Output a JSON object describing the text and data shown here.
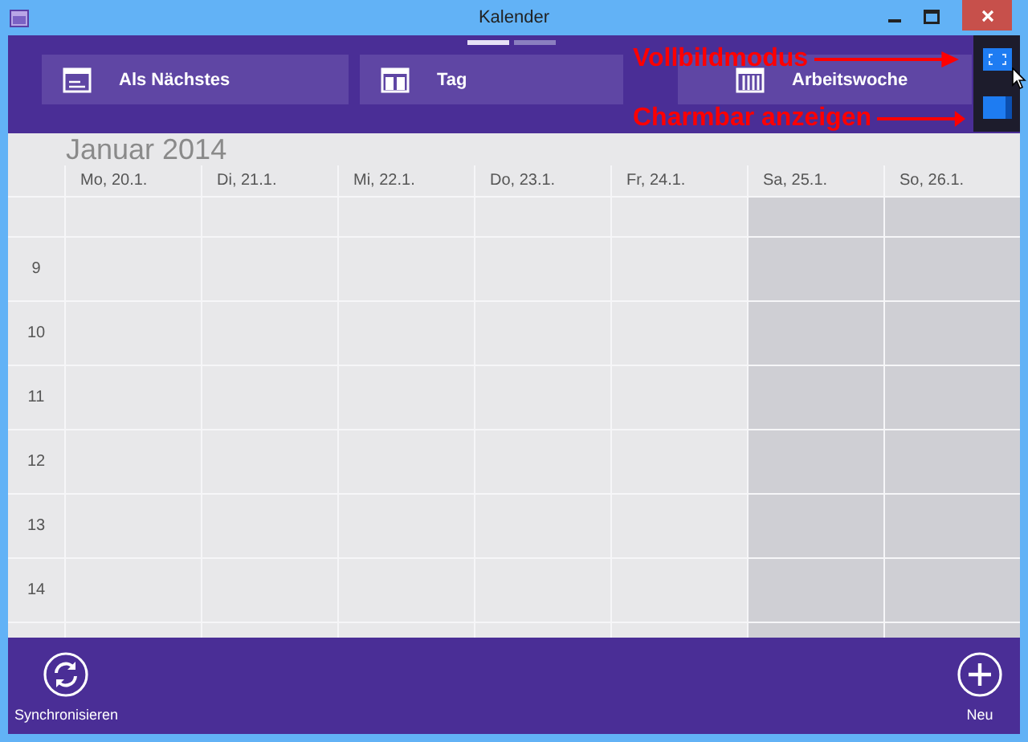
{
  "window": {
    "title": "Kalender"
  },
  "app_bar": {
    "pages": [
      {
        "selected": true
      },
      {
        "selected": false
      }
    ],
    "views": [
      {
        "label": "Als Nächstes",
        "kind": "agenda"
      },
      {
        "label": "Tag",
        "kind": "day"
      },
      {
        "label": "Arbeitswoche",
        "kind": "workweek"
      }
    ]
  },
  "annotations": [
    {
      "text": "Vollbildmodus",
      "kind": "fullscreen"
    },
    {
      "text": "Charmbar anzeigen",
      "kind": "charms"
    }
  ],
  "heading": "Januar 2014",
  "calendar": {
    "days": [
      {
        "label": "Mo, 20.1.",
        "weekend": false
      },
      {
        "label": "Di, 21.1.",
        "weekend": false
      },
      {
        "label": "Mi, 22.1.",
        "weekend": false
      },
      {
        "label": "Do, 23.1.",
        "weekend": false
      },
      {
        "label": "Fr, 24.1.",
        "weekend": false
      },
      {
        "label": "Sa, 25.1.",
        "weekend": true
      },
      {
        "label": "So, 26.1.",
        "weekend": true
      }
    ],
    "hours": [
      "9",
      "10",
      "11",
      "12",
      "13",
      "14"
    ]
  },
  "bottom_bar": {
    "buttons": [
      {
        "label": "Synchronisieren",
        "kind": "sync"
      },
      {
        "label": "Neu",
        "kind": "add"
      }
    ]
  }
}
